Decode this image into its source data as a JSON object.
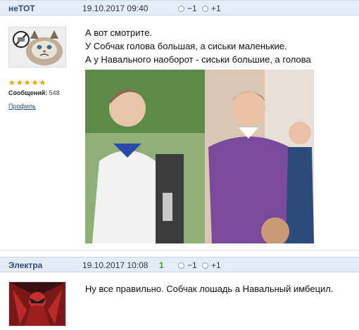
{
  "posts": [
    {
      "author": "неТОТ",
      "date": "19.10.2017 09:40",
      "vote_down": "−1",
      "vote_up": "+1",
      "rating_stars": 5,
      "messages_label": "Сообщений:",
      "messages_count": "548",
      "profile_link": "Профиль",
      "lines": [
        "А вот смотрите.",
        "У Собчак голова большая, а сиськи маленькие.",
        "А у Навального наоборот - сиськи большие, а голова маленькая."
      ]
    },
    {
      "author": "Электра",
      "date": "19.10.2017 10:08",
      "score": "1",
      "vote_down": "−1",
      "vote_up": "+1",
      "lines": [
        "Ну все правильно. Собчак лошадь а Навальный имбецил."
      ]
    }
  ],
  "colors": {
    "header_bg": "#e4edf7",
    "author": "#2a4f7a",
    "score": "#3a9a2a",
    "star": "#f0a400"
  },
  "icons": [
    "no-entry-icon",
    "star-icon",
    "radio-icon"
  ]
}
